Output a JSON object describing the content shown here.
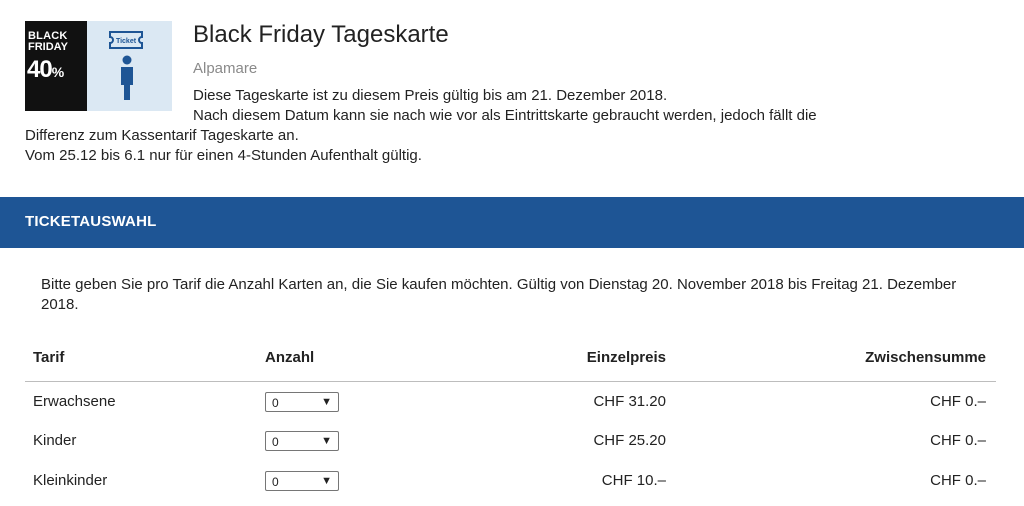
{
  "product": {
    "badge_line1": "BLACK",
    "badge_line2": "FRIDAY",
    "badge_percent": "40",
    "badge_percent_sign": "%",
    "ticket_icon_text": "Ticket",
    "title": "Black Friday Tageskarte",
    "venue": "Alpamare",
    "description_lines": [
      "Diese Tageskarte ist zu diesem Preis gültig bis am 21. Dezember 2018.",
      "Nach diesem Datum kann sie nach wie vor als Eintrittskarte gebraucht werden, jedoch fällt die",
      "Differenz zum Kassentarif Tageskarte an.",
      "Vom 25.12 bis 6.1 nur für einen 4-Stunden Aufenthalt gültig."
    ]
  },
  "section": {
    "title": "TICKETAUSWAHL"
  },
  "intro": "Bitte geben Sie pro Tarif die Anzahl Karten an, die Sie kaufen möchten. Gültig von Dienstag 20. November 2018 bis Freitag 21. Dezember 2018.",
  "table": {
    "headers": {
      "tarif": "Tarif",
      "anzahl": "Anzahl",
      "einzelpreis": "Einzelpreis",
      "zwischensumme": "Zwischensumme"
    },
    "rows": [
      {
        "tarif": "Erwachsene",
        "qty": "0",
        "price": "CHF 31.20",
        "subtotal": "CHF 0.–"
      },
      {
        "tarif": "Kinder",
        "qty": "0",
        "price": "CHF 25.20",
        "subtotal": "CHF 0.–"
      },
      {
        "tarif": "Kleinkinder",
        "qty": "0",
        "price": "CHF 10.–",
        "subtotal": "CHF 0.–"
      }
    ]
  },
  "colors": {
    "accent": "#1e5595",
    "badge_bg": "#111111",
    "badge_panel": "#dbe8f3",
    "icon": "#1e5595",
    "muted": "#8a8a8a"
  }
}
